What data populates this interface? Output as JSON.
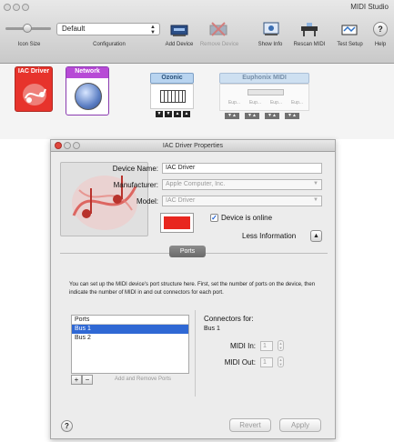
{
  "app": {
    "title": "MIDI Studio",
    "toolbar": {
      "icon_size_label": "Icon Size",
      "configuration_label": "Configuration",
      "configuration_value": "Default",
      "add_device": "Add Device",
      "remove_device": "Remove Device",
      "show_info": "Show Info",
      "rescan_midi": "Rescan MIDI",
      "test_setup": "Test Setup",
      "help": "Help"
    },
    "devices": [
      {
        "name": "IAC Driver"
      },
      {
        "name": "Network"
      },
      {
        "name": "Ozonic",
        "ports": [
          "▼",
          "▼",
          "▲",
          "▲"
        ]
      },
      {
        "name": "Euphonix MIDI",
        "sub_labels": [
          "Eup...",
          "Eup...",
          "Eup...",
          "Eup..."
        ],
        "ports": [
          "▼▲",
          "▼▲",
          "▼▲",
          "▼▲"
        ]
      }
    ]
  },
  "dialog": {
    "title": "IAC Driver Properties",
    "device_name_label": "Device Name:",
    "device_name_value": "IAC Driver",
    "manufacturer_label": "Manufacturer:",
    "manufacturer_value": "Apple Computer, Inc.",
    "model_label": "Model:",
    "model_value": "IAC Driver",
    "device_online_label": "Device is online",
    "device_online_checked": true,
    "less_info_label": "Less Information",
    "less_info_button": "▲",
    "color_swatch": "#e8261f",
    "ports_tab": "Ports",
    "instructions": "You can set up the MIDI device's port structure here.  First, set the number of ports on the device, then indicate the number of MIDI in and out connectors for each port.",
    "ports_list": {
      "header": "Ports",
      "items": [
        "Bus 1",
        "Bus 2"
      ],
      "selected": "Bus 1"
    },
    "add_symbol": "+",
    "remove_symbol": "−",
    "add_remove_label": "Add and Remove Ports",
    "connectors_title": "Connectors for:",
    "connectors_bus": "Bus 1",
    "midi_in_label": "MIDI In:",
    "midi_in_value": "1",
    "midi_out_label": "MIDI Out:",
    "midi_out_value": "1",
    "help_symbol": "?",
    "revert_label": "Revert",
    "apply_label": "Apply"
  }
}
